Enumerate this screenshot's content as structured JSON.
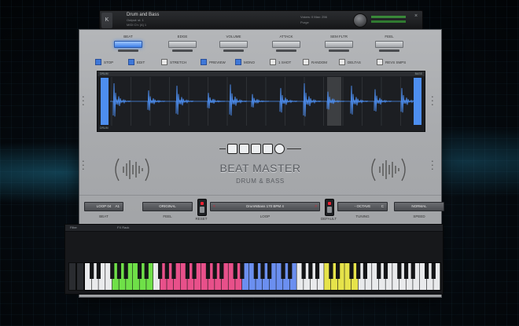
{
  "header": {
    "logo_text": "K",
    "title": "Drum and Bass",
    "sub_lines": [
      "Output: st. 1",
      "MIDI Ch: [A] 1",
      "Memory: 10.3 MB"
    ],
    "mid_lines": [
      "Voices: 0  Max: 256",
      "Purge"
    ]
  },
  "tabs": [
    {
      "label": "BEAT",
      "active": true
    },
    {
      "label": "EDGE",
      "active": false
    },
    {
      "label": "VOLUME",
      "active": false
    },
    {
      "label": "ATTACK",
      "active": false
    },
    {
      "label": "SEM FLTR",
      "active": false
    },
    {
      "label": "FEEL",
      "active": false
    }
  ],
  "options": [
    {
      "label": "STOP",
      "on": true
    },
    {
      "label": "EDIT",
      "on": true
    },
    {
      "label": "STRETCH",
      "on": false
    },
    {
      "label": "PREVIEW",
      "on": true
    },
    {
      "label": "MONO",
      "on": true
    },
    {
      "label": "1 SHOT",
      "on": false
    },
    {
      "label": "RANDOM",
      "on": false
    },
    {
      "label": "DELTAS",
      "on": false
    },
    {
      "label": "REVS SMPS",
      "on": false
    }
  ],
  "wave": {
    "left_label": "DRUM",
    "right_label": "BASS"
  },
  "brand": {
    "line1": "BEAT MASTER",
    "line2": "DRUM & BASS"
  },
  "controls": {
    "beat": {
      "value": "LOOP 04",
      "sub": "A1",
      "caption": "BEAT"
    },
    "feel": {
      "value": "ORIGINAL",
      "caption": "FEEL"
    },
    "reset_caption": "RESET",
    "loop": {
      "value": "DrumNBass 170 BPM 4",
      "caption": "LOOP",
      "left_arrow": "<",
      "right_arrow": ">"
    },
    "default_caption": "DEFAULT",
    "tuning": {
      "value": "- OCTAVE",
      "sub": "C",
      "caption": "TUNING"
    },
    "speed": {
      "value": "NORMAL",
      "caption": "SPEED"
    }
  },
  "lower": {
    "bar_left": "Filter",
    "bar_mid": "FX Rack"
  },
  "colors": {
    "accent_blue": "#4d8ef0",
    "key_green": "#6fe048",
    "key_pink": "#e8508a",
    "key_blue": "#6b8ff0",
    "key_yellow": "#e6e34a"
  }
}
